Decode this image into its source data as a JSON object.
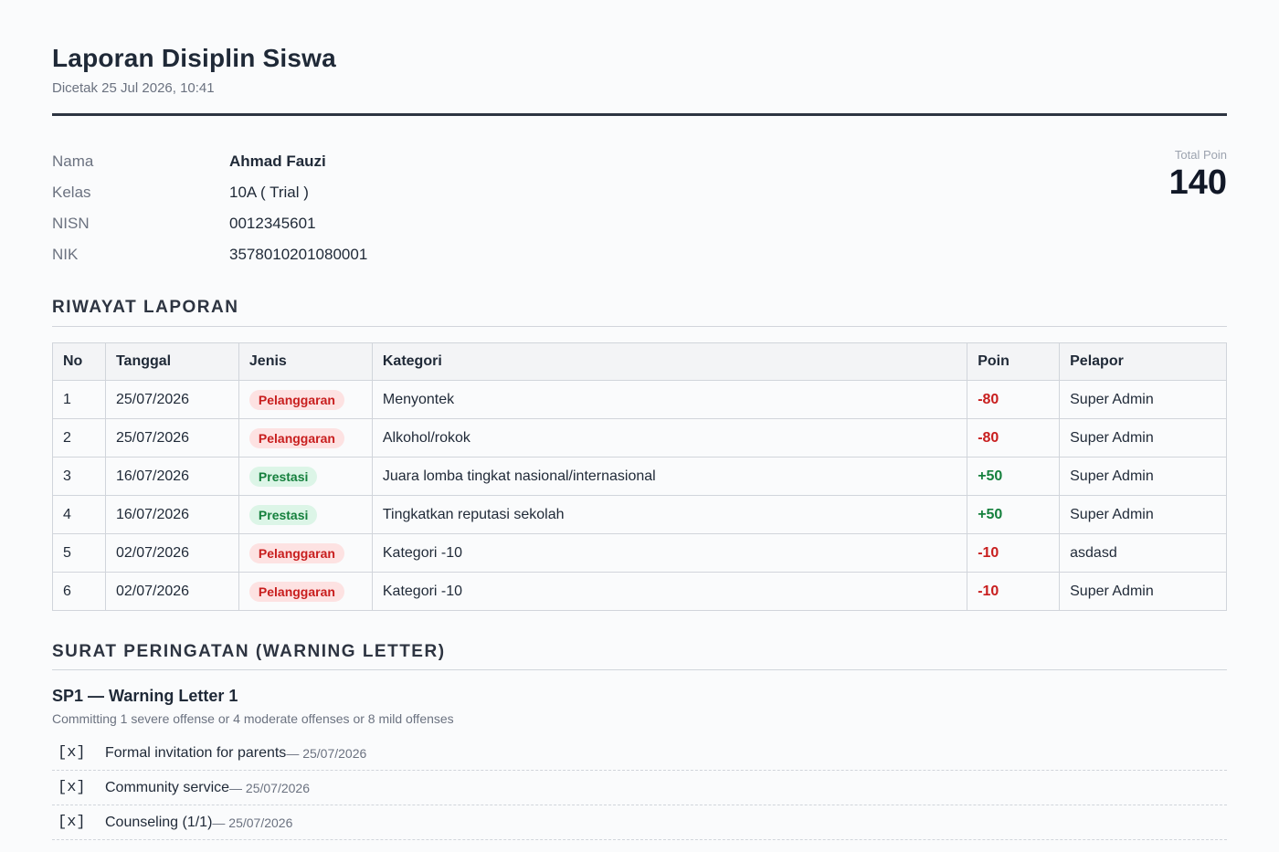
{
  "header": {
    "title": "Laporan Disiplin Siswa",
    "printed": "Dicetak 25 Jul 2026, 10:41"
  },
  "student": [
    {
      "label": "Nama",
      "value": "Ahmad Fauzi"
    },
    {
      "label": "Kelas",
      "value": "10A ( Trial )"
    },
    {
      "label": "NISN",
      "value": "0012345601"
    },
    {
      "label": "NIK",
      "value": "3578010201080001"
    }
  ],
  "total": {
    "label": "Total Poin",
    "value": "140"
  },
  "history": {
    "title": "RIWAYAT LAPORAN",
    "columns": [
      "No",
      "Tanggal",
      "Jenis",
      "Kategori",
      "Poin",
      "Pelapor"
    ],
    "rows": [
      {
        "no": "1",
        "date": "25/07/2026",
        "type": "Pelanggaran",
        "kind": "bad",
        "category": "Menyontek",
        "points": "-80",
        "reporter": "Super Admin"
      },
      {
        "no": "2",
        "date": "25/07/2026",
        "type": "Pelanggaran",
        "kind": "bad",
        "category": "Alkohol/rokok",
        "points": "-80",
        "reporter": "Super Admin"
      },
      {
        "no": "3",
        "date": "16/07/2026",
        "type": "Prestasi",
        "kind": "good",
        "category": "Juara lomba tingkat nasional/internasional",
        "points": "+50",
        "reporter": "Super Admin"
      },
      {
        "no": "4",
        "date": "16/07/2026",
        "type": "Prestasi",
        "kind": "good",
        "category": "Tingkatkan reputasi sekolah",
        "points": "+50",
        "reporter": "Super Admin"
      },
      {
        "no": "5",
        "date": "02/07/2026",
        "type": "Pelanggaran",
        "kind": "bad",
        "category": "Kategori -10",
        "points": "-10",
        "reporter": "asdasd"
      },
      {
        "no": "6",
        "date": "02/07/2026",
        "type": "Pelanggaran",
        "kind": "bad",
        "category": "Kategori -10",
        "points": "-10",
        "reporter": "Super Admin"
      }
    ]
  },
  "warning": {
    "title": "SURAT PERINGATAN (WARNING LETTER)",
    "sp_title": "SP1 — Warning Letter 1",
    "sp_desc": "Committing 1 severe offense or 4 moderate offenses or 8 mild offenses",
    "actions": [
      {
        "mark": "[x]",
        "text": "Formal invitation for parents",
        "date": " — 25/07/2026"
      },
      {
        "mark": "[x]",
        "text": "Community service",
        "date": " — 25/07/2026"
      },
      {
        "mark": "[x]",
        "text": "Counseling (1/1)",
        "date": " — 25/07/2026"
      }
    ]
  }
}
